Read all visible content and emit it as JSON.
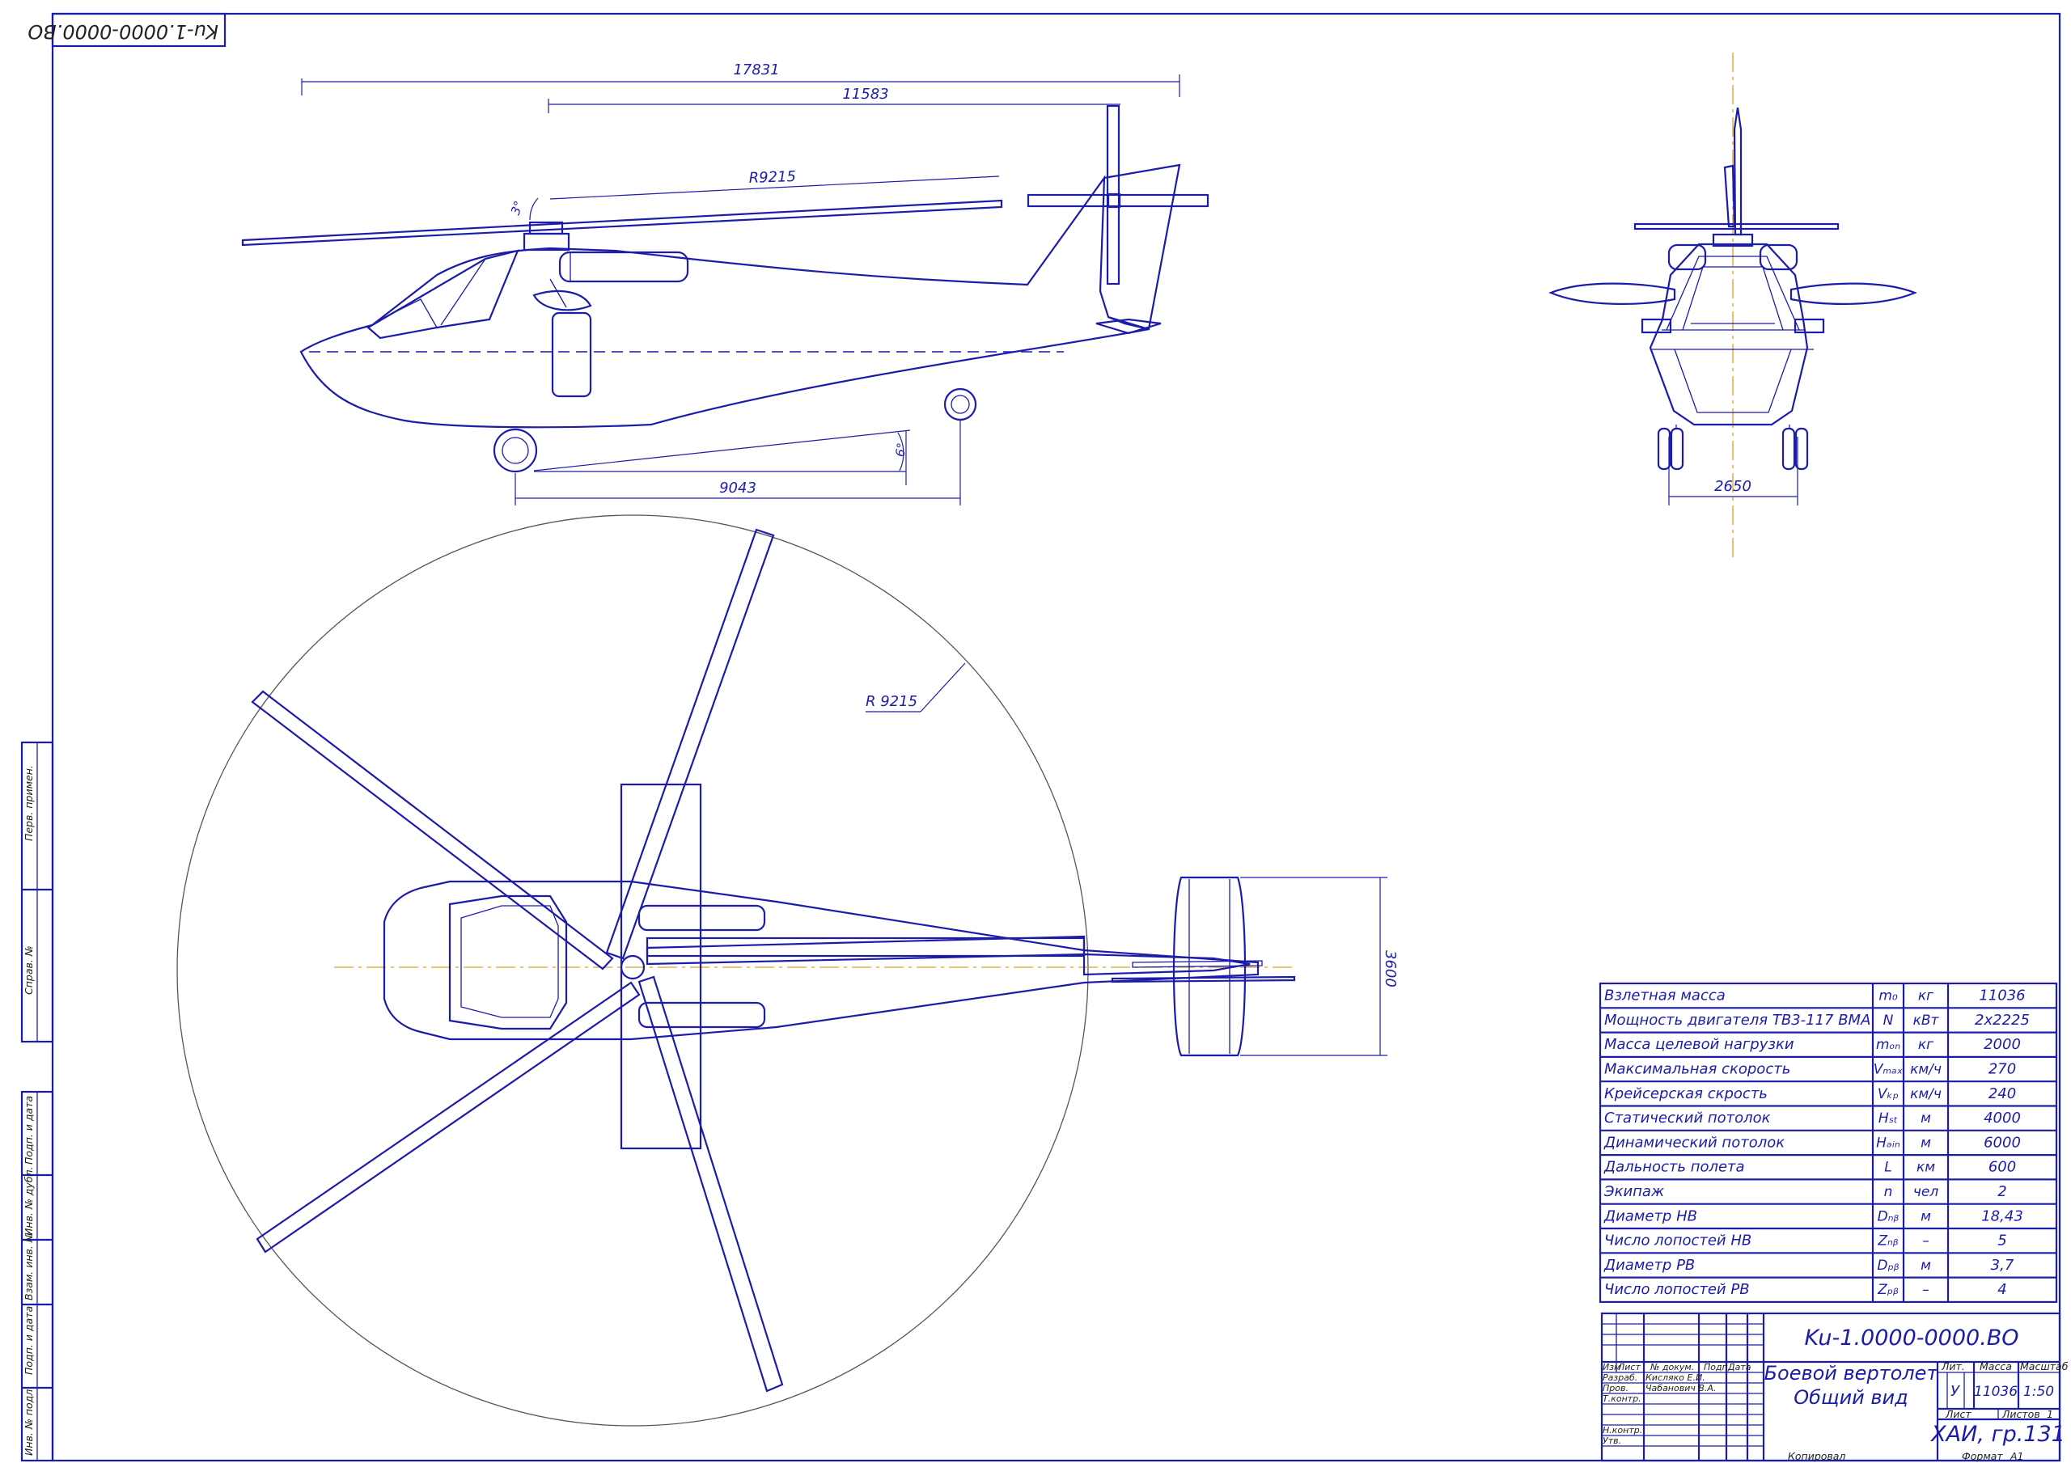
{
  "stamp_code": "Ku-1.0000-0000.BO",
  "side_view": {
    "dim_overall": "17831",
    "dim_tail": "11583",
    "dim_rotor_radius": "R9215",
    "dim_wheelbase": "9043",
    "angle_rotor": "3°",
    "angle_tail": "6°"
  },
  "front_view": {
    "dim_track": "2650"
  },
  "top_view": {
    "dim_rotor_radius": "R 9215",
    "dim_stabilizer": "3600"
  },
  "specs": [
    {
      "param": "Взлетная масса",
      "sym": "m₀",
      "unit": "кг",
      "value": "11036"
    },
    {
      "param": "Мощность двигателя ТВ3-117 ВМА",
      "sym": "N",
      "unit": "кВт",
      "value": "2x2225"
    },
    {
      "param": "Масса целевой нагрузки",
      "sym": "mₒₙ",
      "unit": "кг",
      "value": "2000"
    },
    {
      "param": "Максимальная скорость",
      "sym": "Vₘₐₓ",
      "unit": "км/ч",
      "value": "270"
    },
    {
      "param": "Крейсерская скрость",
      "sym": "Vₖₚ",
      "unit": "км/ч",
      "value": "240"
    },
    {
      "param": "Статический потолок",
      "sym": "Hₛₜ",
      "unit": "м",
      "value": "4000"
    },
    {
      "param": "Динамический потолок",
      "sym": "Hₔᵢₙ",
      "unit": "м",
      "value": "6000"
    },
    {
      "param": "Дальность полета",
      "sym": "L",
      "unit": "км",
      "value": "600"
    },
    {
      "param": "Экипаж",
      "sym": "n",
      "unit": "чел",
      "value": "2"
    },
    {
      "param": "Диаметр НВ",
      "sym": "Dₙᵦ",
      "unit": "м",
      "value": "18,43"
    },
    {
      "param": "Число лопостей НВ",
      "sym": "Zₙᵦ",
      "unit": "–",
      "value": "5"
    },
    {
      "param": "Диаметр РВ",
      "sym": "Dₚᵦ",
      "unit": "м",
      "value": "3,7"
    },
    {
      "param": "Число лопостей РВ",
      "sym": "Zₚᵦ",
      "unit": "–",
      "value": "4"
    }
  ],
  "title_block": {
    "designation": "Ku-1.0000-0000.BO",
    "title_line1": "Боевой вертолет",
    "title_line2": "Общий вид",
    "hdr_izm": "Изм",
    "hdr_list": "Лист",
    "hdr_doc": "№ докум.",
    "hdr_podp": "Подп.",
    "hdr_data": "Дата",
    "razrab_label": "Разраб.",
    "razrab_name": "Кисляко Е.И.",
    "prov_label": "Пров.",
    "prov_name": "Чабанович В.А.",
    "tkontr_label": "Т.контр.",
    "nkontr_label": "Н.контр.",
    "utv_label": "Утв.",
    "lit_label": "Лит.",
    "mass_label": "Масса",
    "scale_label": "Масштаб",
    "lit_value": "У",
    "mass_value": "11036",
    "scale_value": "1:50",
    "sheet_label": "Лист",
    "sheets_label": "Листов",
    "sheets_value": "1",
    "org": "ХАИ, гр.131",
    "copied": "Копировал",
    "format_label": "Формат",
    "format_value": "A1"
  },
  "side_strip": [
    "Перв. примен.",
    "Справ. №",
    "Подп. и дата",
    "Инв. № дубл.",
    "Взам. инв. №",
    "Подп. и дата",
    "Инв. № подл."
  ]
}
